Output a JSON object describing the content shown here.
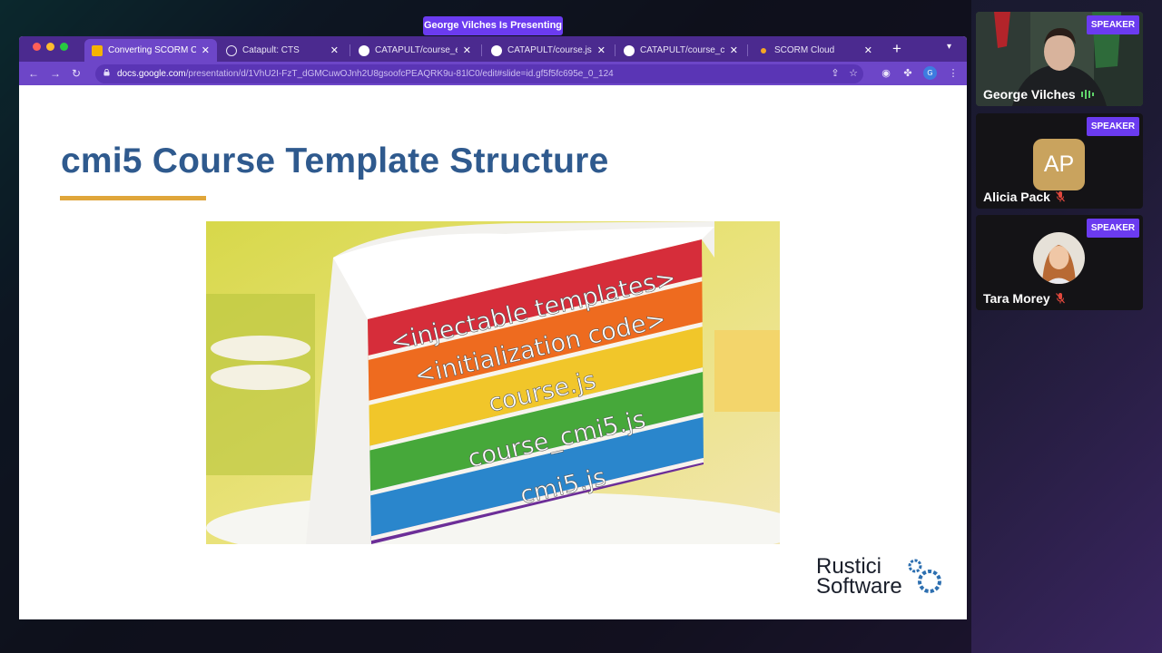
{
  "meeting": {
    "presenting_banner": "George Vilches Is Presenting"
  },
  "browser": {
    "tabs": [
      {
        "label": "Converting SCORM Co",
        "favicon": "google-slides-icon",
        "active": true
      },
      {
        "label": "Catapult: CTS",
        "favicon": "globe-icon",
        "active": false
      },
      {
        "label": "CATAPULT/course_exa",
        "favicon": "github-icon",
        "active": false
      },
      {
        "label": "CATAPULT/course.js a",
        "favicon": "github-icon",
        "active": false
      },
      {
        "label": "CATAPULT/course_cm",
        "favicon": "github-icon",
        "active": false
      },
      {
        "label": "SCORM Cloud",
        "favicon": "scorm-cloud-icon",
        "active": false
      }
    ],
    "url_host": "docs.google.com",
    "url_path": "/presentation/d/1VhU2I-FzT_dGMCuwOJnh2U8gsoofcPEAQRK9u-81lC0/edit#slide=id.gf5f5fc695e_0_124",
    "profile_initial": "G"
  },
  "slide": {
    "title": "cmi5 Course Template Structure",
    "cake_layers": [
      "<injectable templates>",
      "<initialization code>",
      "course.js",
      "course_cmi5.js",
      "cmi5.js"
    ],
    "logo_line1": "Rustici",
    "logo_line2": "Software"
  },
  "participants": [
    {
      "name": "George Vilches",
      "tag": "SPEAKER",
      "muted": false
    },
    {
      "name": "Alicia Pack",
      "tag": "SPEAKER",
      "initials": "AP",
      "muted": true
    },
    {
      "name": "Tara Morey",
      "tag": "SPEAKER",
      "muted": true
    }
  ],
  "colors": {
    "accent": "#6b3bf0",
    "title_blue": "#2f5a8e",
    "underline_gold": "#e0a63a",
    "browser_frame": "#6d46c8"
  }
}
